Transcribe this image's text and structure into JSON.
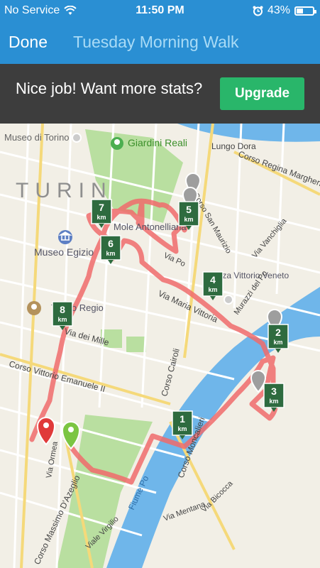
{
  "status_bar": {
    "carrier": "No Service",
    "time": "11:50 PM",
    "battery_percent": "43%",
    "battery_level": 0.43,
    "icons": [
      "wifi-icon",
      "alarm-icon",
      "battery-icon"
    ]
  },
  "nav": {
    "done_label": "Done",
    "title": "Tuesday Morning Walk"
  },
  "promo": {
    "message": "Nice job! Want more stats?",
    "button_label": "Upgrade"
  },
  "map": {
    "city_label": "TURIN",
    "poi": {
      "giardini": "Giardini Reali",
      "museo": "Museo Egizio",
      "teatro": "Teatro Regio",
      "mole": "Mole Antonelliana",
      "piazza": "Piazza Vittorio Veneto",
      "torino": "Museo di Torino"
    },
    "streets": {
      "corso_regina": "Corso Regina Margherita",
      "corso_san_maurizio": "Corso San Maurizio",
      "via_vanchiglia": "Via Vanchiglia",
      "via_po": "Via Po",
      "via_maria_vittoria": "Via Maria Vittoria",
      "murazzi": "Murazzi del Po",
      "via_dei_mille": "Via dei Mille",
      "corso_vittorio": "Corso Vittorio Emanuele II",
      "corso_cairoli": "Corso Cairoli",
      "corso_moncalieri": "Corso Moncalieri",
      "fiume_po": "Fiume Po",
      "via_ormea": "Via Ormea",
      "via_mentana": "Via Mentana",
      "via_bicocca": "Via Bicocca",
      "corso_massimo": "Corso Massimo D'Azeglio",
      "viale_virgilio": "Viale Virgilio",
      "lungo_dora": "Lungo Dora"
    },
    "km_markers": [
      {
        "label": "1",
        "unit": "km"
      },
      {
        "label": "2",
        "unit": "km"
      },
      {
        "label": "3",
        "unit": "km"
      },
      {
        "label": "4",
        "unit": "km"
      },
      {
        "label": "5",
        "unit": "km"
      },
      {
        "label": "6",
        "unit": "km"
      },
      {
        "label": "7",
        "unit": "km"
      },
      {
        "label": "8",
        "unit": "km"
      }
    ],
    "colors": {
      "route": "#f06b6b",
      "marker": "#2e6b3f",
      "start_pin": "#7bc542",
      "end_pin": "#e03a3a",
      "river": "#6fb6ea",
      "park": "#b9dfa0"
    }
  }
}
